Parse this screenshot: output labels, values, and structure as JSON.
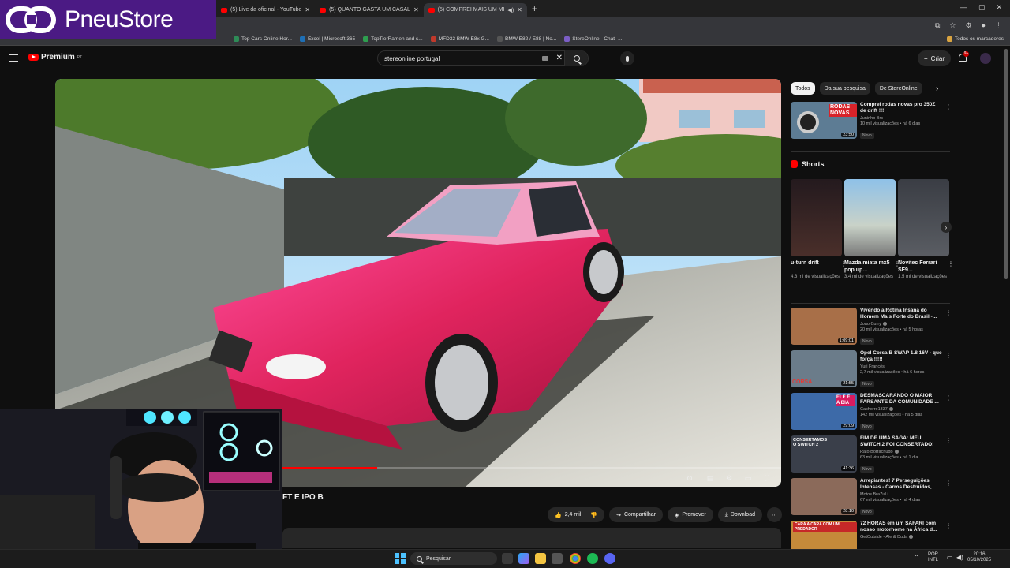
{
  "overlay": {
    "brand": "PneuStore"
  },
  "browser": {
    "tabs": [
      {
        "label": "(5) Live da oficinal - YouTube",
        "active": false
      },
      {
        "label": "(5) QUANTO GASTA UM CASAL",
        "active": false
      },
      {
        "label": "(5) COMPREI MAIS UM MI",
        "active": true
      }
    ],
    "bookmarks": [
      "Top Cars Online Hor...",
      "Excel | Microsoft 365",
      "TopTierRamen and s...",
      "MFD32 BMW E8x G...",
      "BMW E82 / E88 | No...",
      "StereOnline - Chat -..."
    ],
    "bookmarks_right": "Todos os marcadores"
  },
  "youtube": {
    "logo": "Premium",
    "logo_region": "PT",
    "search_value": "stereonline portugal",
    "create_label": "Criar",
    "notifications": "9+"
  },
  "video": {
    "title_visible": "FT E IPO B",
    "progress": 0.19,
    "actions": {
      "likes": "2,4 mil",
      "share": "Compartilhar",
      "promote": "Promover",
      "download": "Download"
    }
  },
  "sidebar": {
    "chips": [
      "Todos",
      "Da sua pesquisa",
      "De StereOnline"
    ],
    "first": {
      "title": "Comprei rodas novas pro 350Z de drift !!!",
      "channel": "Juninho Brc",
      "meta": "10 mil visualizações • há 6 dias",
      "badge": "Novo",
      "duration": "23:50",
      "thumb_text": "RODAS NOVAS"
    },
    "shorts_title": "Shorts",
    "shorts": [
      {
        "title": "u-turn drift",
        "views": "4,3 mi de visualizações"
      },
      {
        "title": "Mazda miata mx5 pop up...",
        "views": "3,4 mi de visualizações"
      },
      {
        "title": "Novitec Ferrari SF9...",
        "views": "1,5 mi de visualizações"
      }
    ],
    "videos": [
      {
        "title": "Vivendo a Rotina Insana do Homem Mais Forte do Brasil -...",
        "channel": "Joao Curry",
        "meta": "20 mil visualizações • há 5 horas",
        "badge": "Novo",
        "duration": "1:09:01",
        "color": "#a86f48"
      },
      {
        "title": "Opel Corsa B SWAP 1.8 16V - que força !!!!!",
        "channel": "Yuri Francês",
        "meta": "2,7 mil visualizações • há 6 horas",
        "badge": "Novo",
        "duration": "21:55",
        "color": "#6b7c8a",
        "thumb_text": "CORSA"
      },
      {
        "title": "DESMASCARANDO O MAIOR FARSANTE DA COMUNIDADE ...",
        "channel": "Cachorro1337",
        "meta": "142 mil visualizações • há 5 dias",
        "badge": "Novo",
        "duration": "29:09",
        "color": "#3d6aa8",
        "thumb_text": "ELE É A BIA"
      },
      {
        "title": "FIM DE UMA SAGA: MEU SWITCH 2 FOI CONSERTADO!",
        "channel": "Rato Borrachudo",
        "meta": "63 mil visualizações • há 1 dia",
        "badge": "Novo",
        "duration": "41:36",
        "color": "#3a3f4a",
        "thumb_text": "CONSERTAMOS O SWITCH 2"
      },
      {
        "title": "Arrepiantes! 7 Perseguições Intensas - Carros Destruídos,...",
        "channel": "Motos BraZuLi",
        "meta": "67 mil visualizações • há 4 dias",
        "badge": "Novo",
        "duration": "28:10",
        "color": "#8b6a5a"
      },
      {
        "title": "72 HORAS em um SAFARI com nosso motorhome na África d...",
        "channel": "GetOutside - Ale & Duda",
        "meta": "",
        "badge": "",
        "duration": "",
        "color": "#c58a3a",
        "thumb_text": "CARA A CARA COM UM PREDADOR"
      }
    ]
  },
  "taskbar": {
    "search": "Pesquisar",
    "lang": "POR",
    "layout": "INTL",
    "time": "20:16",
    "date": "05/10/2025"
  },
  "colors": {
    "accent": "#ff0000",
    "overlay": "#4b1a84",
    "car": "#e0245e"
  }
}
